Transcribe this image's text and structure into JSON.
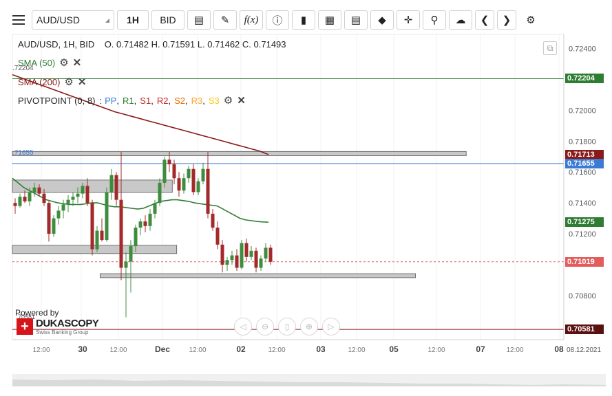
{
  "toolbar": {
    "symbol": "AUD/USD",
    "timeframe": "1H",
    "price_type": "BID",
    "icons": [
      "menu-icon",
      "candles-icon",
      "draw-pen-icon",
      "function-icon",
      "info-icon",
      "bar-chart-icon",
      "calendar-icon",
      "report-icon",
      "lock-icon",
      "crosshair-icon",
      "zoom-icon",
      "cloud-upload-icon",
      "chevron-left-icon",
      "chevron-right-icon",
      "gear-icon"
    ]
  },
  "info_line": "AUD/USD, 1H, BID    O. 0.71482 H. 0.71591 L. 0.71462 C. 0.71493",
  "legend": {
    "sma50": "SMA (50)",
    "sma200": "SMA (200)",
    "pivot_label": "PIVOTPOINT (0, 8)",
    "pivot_colon": ":",
    "pivot_items": [
      {
        "text": "PP",
        "color": "#3a7bd5"
      },
      {
        "text": "R1",
        "color": "#2e7d32"
      },
      {
        "text": "S1",
        "color": "#c62828"
      },
      {
        "text": "R2",
        "color": "#c62828"
      },
      {
        "text": "S2",
        "color": "#ef6c00"
      },
      {
        "text": "R3",
        "color": "#f9a825"
      },
      {
        "text": "S3",
        "color": "#f9c80e"
      }
    ]
  },
  "left_labels": {
    "upper": ".72204",
    "mid": ".71655",
    "lower": "70581"
  },
  "branding": {
    "powered": "Powered by",
    "name": "DUKASCOPY",
    "tagline": "Swiss Banking Group"
  },
  "colors": {
    "sma50": "#2e7d32",
    "sma200": "#8b1a1a",
    "pp": "#3a7bd5",
    "r1": "#2e7d32",
    "s1": "#8b1a1a",
    "current": "#e35d5d",
    "bull": "#3f8c3f",
    "bear": "#a22a2a"
  },
  "chart_data": {
    "type": "candlestick",
    "instrument": "AUD/USD",
    "timeframe": "1H",
    "ohlc_last": {
      "open": 0.71482,
      "high": 0.71591,
      "low": 0.71462,
      "close": 0.71493
    },
    "y_ticks": [
      "0.72400",
      "0.72000",
      "0.71800",
      "0.71600",
      "0.71400",
      "0.71200",
      "0.70800"
    ],
    "x_ticks": [
      "12:00",
      "30",
      "12:00",
      "Dec",
      "12:00",
      "02",
      "12:00",
      "03",
      "12:00",
      "05",
      "12:00",
      "07",
      "12:00",
      "08"
    ],
    "date_label": "08.12.2021",
    "price_labels": [
      {
        "value": "0.72204",
        "color": "#2e7d32",
        "text_color": "#ffffff"
      },
      {
        "value": "0.71713",
        "color": "#8b1a1a",
        "text_color": "#ffffff"
      },
      {
        "value": "0.71655",
        "color": "#3a7bd5",
        "text_color": "#ffffff"
      },
      {
        "value": "0.71275",
        "color": "#2e7d32",
        "text_color": "#ffffff"
      },
      {
        "value": "0.71019",
        "color": "#e35d5d",
        "text_color": "#ffffff"
      },
      {
        "value": "0.70581",
        "color": "#5a1010",
        "text_color": "#ffffff"
      }
    ],
    "horizontal_lines": [
      {
        "name": "R1",
        "value": 0.72204,
        "color": "#2e7d32"
      },
      {
        "name": "PP",
        "value": 0.71655,
        "color": "#3a7bd5"
      },
      {
        "name": "S1",
        "value": 0.70581,
        "color": "#8b1a1a"
      },
      {
        "name": "current",
        "value": 0.71019,
        "color": "#e35d5d",
        "dashed": true
      }
    ],
    "zones": [
      {
        "x0": 0,
        "x1": 0.823,
        "y0": 0.71733,
        "y1": 0.71705
      },
      {
        "x0": 0,
        "x1": 0.29,
        "y0": 0.71548,
        "y1": 0.71468
      },
      {
        "x0": 0,
        "x1": 0.298,
        "y0": 0.71126,
        "y1": 0.71072
      },
      {
        "x0": 0.159,
        "x1": 0.731,
        "y0": 0.70942,
        "y1": 0.70916
      }
    ],
    "ylim": [
      0.70515,
      0.72491
    ],
    "candles": [
      [
        0.714,
        0.7143,
        0.7133,
        0.7138
      ],
      [
        0.7138,
        0.7146,
        0.7137,
        0.7144
      ],
      [
        0.7144,
        0.7148,
        0.714,
        0.7141
      ],
      [
        0.7141,
        0.715,
        0.7138,
        0.7147
      ],
      [
        0.7147,
        0.7153,
        0.7144,
        0.715
      ],
      [
        0.715,
        0.7152,
        0.7144,
        0.7146
      ],
      [
        0.7146,
        0.7149,
        0.7138,
        0.714
      ],
      [
        0.714,
        0.7141,
        0.7115,
        0.712
      ],
      [
        0.712,
        0.7132,
        0.7118,
        0.713
      ],
      [
        0.713,
        0.7138,
        0.7126,
        0.7135
      ],
      [
        0.7135,
        0.7142,
        0.713,
        0.7139
      ],
      [
        0.7139,
        0.7145,
        0.7134,
        0.7142
      ],
      [
        0.7142,
        0.7147,
        0.7138,
        0.7144
      ],
      [
        0.7144,
        0.715,
        0.714,
        0.7146
      ],
      [
        0.7146,
        0.7153,
        0.7143,
        0.7151
      ],
      [
        0.7151,
        0.7156,
        0.7138,
        0.714
      ],
      [
        0.714,
        0.7142,
        0.7106,
        0.711
      ],
      [
        0.711,
        0.7125,
        0.7108,
        0.7122
      ],
      [
        0.7122,
        0.713,
        0.7115,
        0.7116
      ],
      [
        0.7116,
        0.715,
        0.7115,
        0.7147
      ],
      [
        0.7147,
        0.7162,
        0.7142,
        0.7158
      ],
      [
        0.7158,
        0.716,
        0.7138,
        0.7142
      ],
      [
        0.7142,
        0.7173,
        0.709,
        0.7098
      ],
      [
        0.7098,
        0.7108,
        0.7066,
        0.7102
      ],
      [
        0.7102,
        0.7116,
        0.7082,
        0.7112
      ],
      [
        0.7112,
        0.7126,
        0.7108,
        0.7124
      ],
      [
        0.7124,
        0.713,
        0.7119,
        0.7128
      ],
      [
        0.7128,
        0.7132,
        0.7121,
        0.7125
      ],
      [
        0.7125,
        0.7136,
        0.7122,
        0.7133
      ],
      [
        0.7133,
        0.7142,
        0.713,
        0.714
      ],
      [
        0.714,
        0.7156,
        0.7138,
        0.7153
      ],
      [
        0.7153,
        0.717,
        0.715,
        0.7168
      ],
      [
        0.7168,
        0.7173,
        0.716,
        0.7165
      ],
      [
        0.7165,
        0.7168,
        0.7152,
        0.7156
      ],
      [
        0.7156,
        0.716,
        0.7144,
        0.7148
      ],
      [
        0.7148,
        0.7159,
        0.7146,
        0.7156
      ],
      [
        0.7156,
        0.7164,
        0.7153,
        0.7162
      ],
      [
        0.7162,
        0.7165,
        0.7145,
        0.7147
      ],
      [
        0.7147,
        0.7156,
        0.7145,
        0.7154
      ],
      [
        0.7154,
        0.7166,
        0.7152,
        0.7162
      ],
      [
        0.7162,
        0.7173,
        0.713,
        0.7133
      ],
      [
        0.7133,
        0.7136,
        0.7122,
        0.7124
      ],
      [
        0.7124,
        0.7128,
        0.711,
        0.7113
      ],
      [
        0.7113,
        0.7116,
        0.7095,
        0.71
      ],
      [
        0.71,
        0.7105,
        0.7096,
        0.7103
      ],
      [
        0.7103,
        0.7109,
        0.71,
        0.7106
      ],
      [
        0.7106,
        0.711,
        0.7096,
        0.7098
      ],
      [
        0.7098,
        0.7116,
        0.7097,
        0.7114
      ],
      [
        0.7114,
        0.7117,
        0.7102,
        0.7105
      ],
      [
        0.7105,
        0.7112,
        0.7103,
        0.7109
      ],
      [
        0.7109,
        0.7111,
        0.7095,
        0.7098
      ],
      [
        0.7098,
        0.7106,
        0.7096,
        0.7104
      ],
      [
        0.7104,
        0.7114,
        0.7102,
        0.7111
      ],
      [
        0.7111,
        0.7113,
        0.71,
        0.71019
      ]
    ],
    "sma50": [
      0.7156,
      0.7153,
      0.715,
      0.7148,
      0.7146,
      0.7144,
      0.7142,
      0.7141,
      0.714,
      0.71395,
      0.7139,
      0.7139,
      0.7139,
      0.71395,
      0.714,
      0.714,
      0.7139,
      0.7138,
      0.71375,
      0.71375,
      0.7137,
      0.71365,
      0.7136,
      0.71365,
      0.7138,
      0.71395,
      0.7141,
      0.71415,
      0.7142,
      0.7142,
      0.71415,
      0.7141,
      0.714,
      0.71395,
      0.7139,
      0.71385,
      0.7138,
      0.7136,
      0.7134,
      0.7132,
      0.713,
      0.7129,
      0.71285,
      0.7128,
      0.71277,
      0.71275
    ],
    "sma200": [
      0.7223,
      0.7221,
      0.7219,
      0.7217,
      0.7215,
      0.7213,
      0.7211,
      0.7209,
      0.7207,
      0.7205,
      0.7203,
      0.7201,
      0.7199,
      0.71975,
      0.7196,
      0.71945,
      0.7193,
      0.71915,
      0.719,
      0.71885,
      0.7187,
      0.71855,
      0.7184,
      0.71825,
      0.7181,
      0.71795,
      0.7178,
      0.71765,
      0.7175,
      0.71735,
      0.71713
    ]
  }
}
